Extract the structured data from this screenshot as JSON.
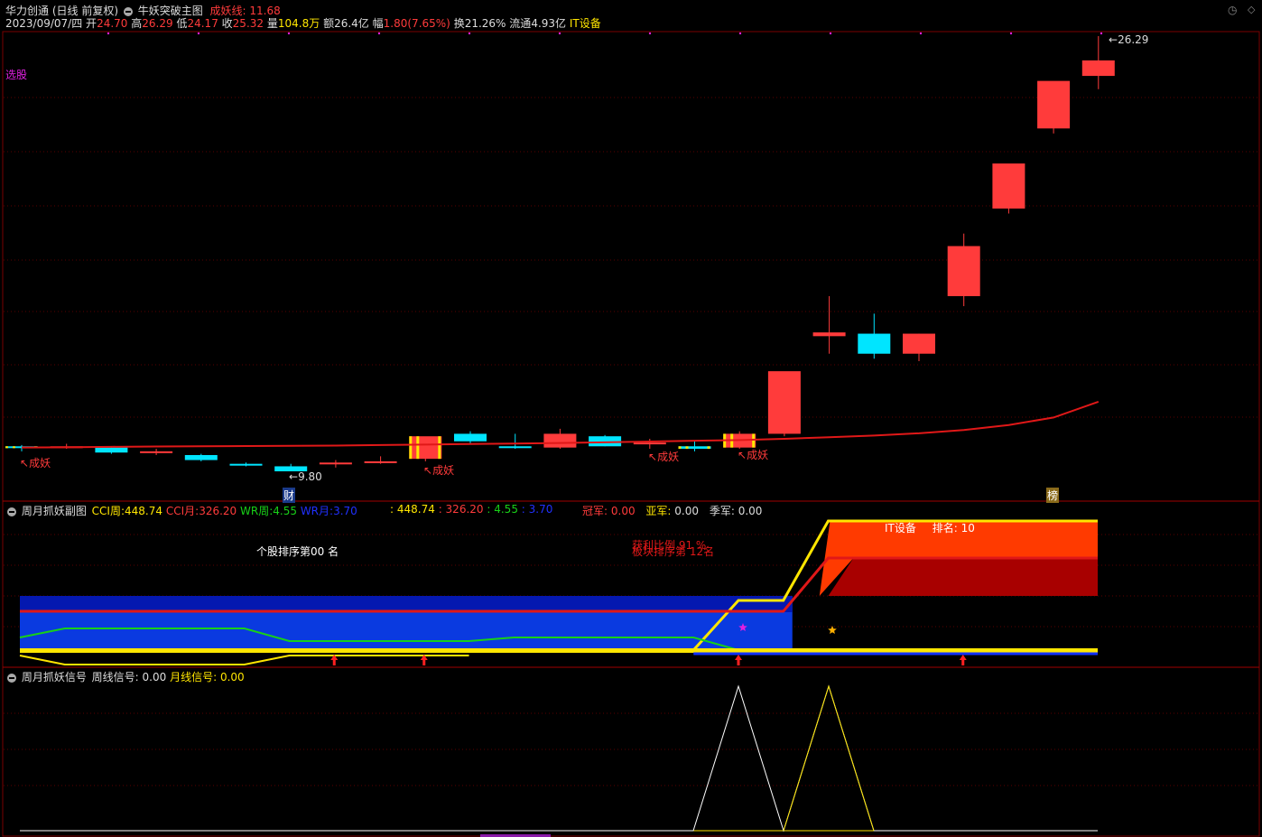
{
  "header": {
    "stock_name": "华力创通",
    "period": "(日线 前复权)",
    "indicator_name": "牛妖突破主图",
    "line_label": "成妖线",
    "line_value": "11.68",
    "date": "2023/09/07/四",
    "open_label": "开",
    "open": "24.70",
    "high_label": "高",
    "high": "26.29",
    "low_label": "低",
    "low": "24.17",
    "close_label": "收",
    "close": "25.32",
    "vol_label": "量",
    "vol": "104.8万",
    "amount_label": "额",
    "amount": "26.4亿",
    "change_label": "幅",
    "change": "1.80(7.65%)",
    "turnover_label": "换",
    "turnover": "21.26%",
    "float_label": "流通",
    "float": "4.93亿",
    "sector": "IT设备"
  },
  "main": {
    "select_label": "选股",
    "high_marker": "26.29",
    "low_marker": "9.80",
    "tag_cheng_yao": "成妖",
    "tag_cai": "财",
    "tag_bang": "榜"
  },
  "sub1": {
    "title": "周月抓妖副图",
    "cci_week_label": "CCI周:",
    "cci_week": "448.74",
    "cci_month_label": "CCI月:",
    "cci_month": "326.20",
    "wr_week_label": "WR周:",
    "wr_week": "4.55",
    "wr_month_label": "WR月:",
    "wr_month": "3.70",
    "v1": ": 448.74",
    "v2": ": 326.20",
    "v3": ": 4.55",
    "v4": ": 3.70",
    "champ_label": "冠军:",
    "champ": "0.00",
    "runner_label": "亚军:",
    "runner": "0.00",
    "third_label": "季军:",
    "third": "0.00",
    "rank_text": "个股排序第",
    "rank_num": "00",
    "rank_suffix": "名",
    "profit_text": "获利比例 91 %",
    "sector_rank_text": "板块排序第 12名",
    "sector_label": "IT设备",
    "sector_rank_label": "排名:",
    "sector_rank": "10"
  },
  "sub2": {
    "title": "周月抓妖信号",
    "week_label": "周线信号:",
    "week": "0.00",
    "month_label": "月线信号:",
    "month": "0.00"
  },
  "colors": {
    "up": "#ff3b3b",
    "down": "#00e5ff",
    "line": "#e01818",
    "yellow": "#ffe600",
    "panel_blue": "#0a2fe0",
    "orange": "#ff3a00",
    "darkred": "#a80000",
    "green": "#18d018"
  },
  "chart_data": {
    "type": "candlestick",
    "title": "牛妖突破主图",
    "series": [
      {
        "name": "K",
        "ohlc": [
          [
            9.9,
            9.95,
            9.7,
            9.85
          ],
          [
            9.9,
            10.0,
            9.8,
            9.9
          ],
          [
            9.85,
            9.9,
            9.6,
            9.65
          ],
          [
            9.7,
            9.8,
            9.55,
            9.7
          ],
          [
            9.55,
            9.6,
            9.3,
            9.35
          ],
          [
            9.2,
            9.25,
            9.1,
            9.15
          ],
          [
            9.1,
            9.2,
            9.0,
            8.9
          ],
          [
            9.2,
            9.35,
            9.05,
            9.25
          ],
          [
            9.25,
            9.5,
            9.2,
            9.3
          ],
          [
            9.4,
            10.2,
            9.3,
            10.3
          ],
          [
            10.4,
            10.5,
            10.0,
            10.1
          ],
          [
            9.9,
            10.4,
            9.8,
            9.85
          ],
          [
            9.85,
            10.6,
            9.8,
            10.4
          ],
          [
            10.3,
            10.35,
            9.9,
            9.9
          ],
          [
            10.0,
            10.2,
            9.8,
            10.05
          ],
          [
            9.9,
            10.1,
            9.7,
            9.8
          ],
          [
            9.85,
            10.5,
            9.8,
            10.4
          ],
          [
            10.4,
            12.8,
            10.3,
            12.9
          ],
          [
            14.3,
            15.9,
            13.6,
            14.45
          ],
          [
            14.4,
            15.2,
            13.4,
            13.6
          ],
          [
            13.6,
            14.4,
            13.3,
            14.4
          ],
          [
            15.9,
            18.4,
            15.5,
            17.9
          ],
          [
            19.4,
            21.1,
            19.2,
            21.2
          ],
          [
            22.6,
            24.2,
            22.4,
            24.5
          ],
          [
            24.7,
            26.29,
            24.17,
            25.32
          ]
        ]
      },
      {
        "name": "成妖线",
        "values": [
          9.85,
          9.86,
          9.88,
          9.89,
          9.9,
          9.91,
          9.92,
          9.93,
          9.95,
          9.97,
          9.99,
          10.01,
          10.03,
          10.06,
          10.09,
          10.12,
          10.15,
          10.2,
          10.26,
          10.33,
          10.42,
          10.55,
          10.75,
          11.05,
          11.68
        ]
      }
    ],
    "sub1": {
      "cci_week": [
        230,
        230,
        230,
        230,
        230,
        230,
        230,
        230,
        230,
        230,
        230,
        230,
        230,
        230,
        230,
        230,
        230,
        230,
        420,
        448.74,
        448.74,
        448.74,
        448.74,
        448.74,
        448.74
      ],
      "cci_month": [
        210,
        210,
        210,
        210,
        210,
        210,
        210,
        210,
        210,
        210,
        210,
        210,
        210,
        210,
        210,
        210,
        210,
        210,
        230,
        326.2,
        326.2,
        326.2,
        326.2,
        326.2,
        326.2
      ],
      "wr_week": [
        95,
        80,
        80,
        80,
        80,
        80,
        60,
        60,
        60,
        60,
        60,
        62,
        62,
        62,
        62,
        62,
        58,
        52,
        52,
        52,
        52,
        52,
        52,
        52,
        52
      ],
      "wr_month": [
        55,
        45,
        35,
        35,
        35,
        35,
        48,
        50,
        50,
        50,
        50,
        50,
        50,
        50,
        50,
        50,
        50,
        50,
        50,
        50,
        50,
        50,
        50,
        50,
        50
      ]
    },
    "sub2": {
      "week_signal": [
        0,
        0,
        0,
        0,
        0,
        0,
        0,
        0,
        0,
        0,
        0,
        0,
        0,
        0,
        0,
        0,
        1,
        0,
        1,
        0,
        0,
        0,
        0,
        0,
        0
      ],
      "month_signal": [
        0,
        0,
        0,
        0,
        0,
        0,
        0,
        0,
        0,
        0,
        0,
        0,
        0,
        0,
        0,
        0,
        0,
        0,
        0,
        0,
        0,
        0,
        0,
        0,
        0
      ]
    }
  }
}
